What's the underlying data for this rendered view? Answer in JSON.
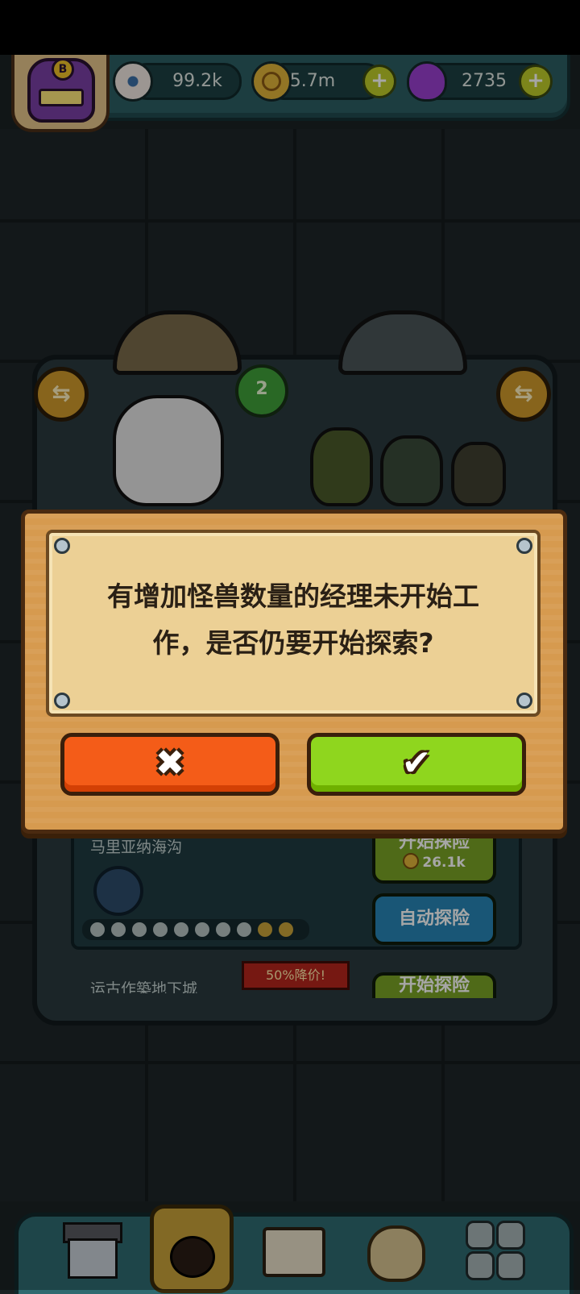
{
  "hud": {
    "avatar_badge": "B",
    "resources": [
      {
        "icon": "eyeball-icon",
        "value": "99.2k"
      },
      {
        "icon": "coin-icon",
        "value": "5.7m"
      },
      {
        "icon": "potion-icon",
        "value": "2735"
      }
    ],
    "plus_label": "+"
  },
  "machine": {
    "clover_count": "2",
    "swap_glyph": "⇆"
  },
  "dialog": {
    "message_line1": "有增加怪兽数量的经理未开始工",
    "message_line2": "作，是否仍要开始探索?",
    "cancel_glyph": "✖",
    "confirm_glyph": "✔"
  },
  "expedition_list": {
    "item1_title": "马里亚纳海沟",
    "start_button": "开始探险",
    "start_cost": "26.1k",
    "auto_button": "自动探险",
    "discount_tag": "50%降价!",
    "item2_title_partial": "运古作築地下城",
    "item2_start_partial": "开始探险"
  },
  "colors": {
    "cancel_button": "#f45c18",
    "confirm_button": "#8fd61e",
    "parchment": "#ecd095",
    "wood_frame": "#d69a4f"
  }
}
